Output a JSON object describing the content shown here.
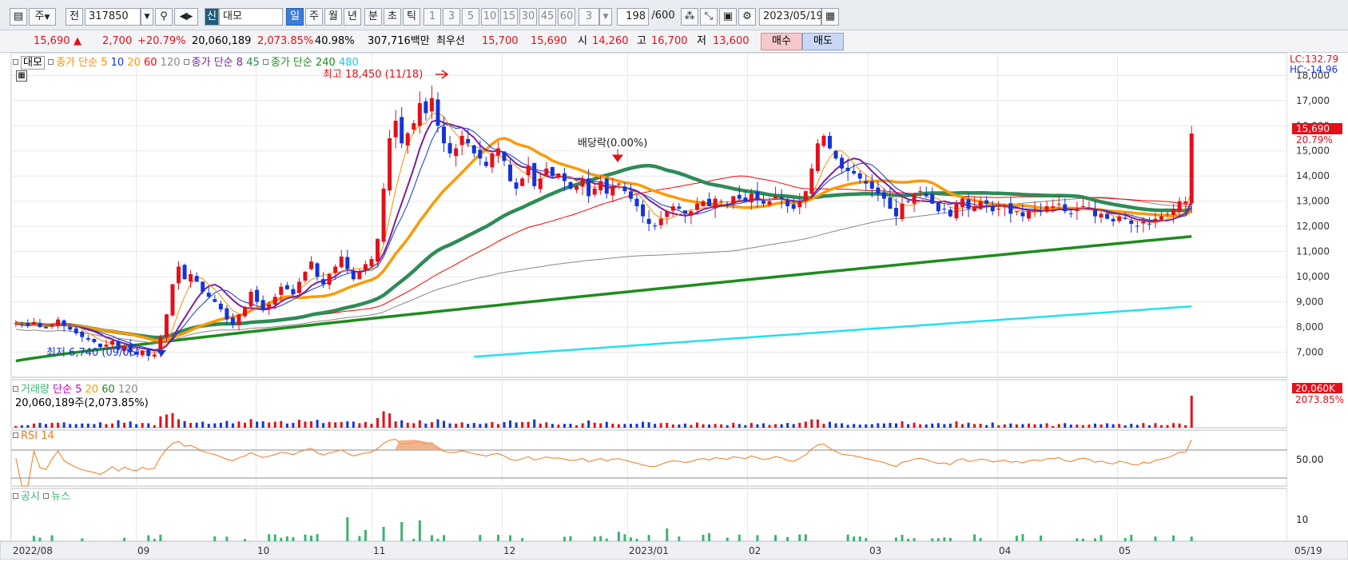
{
  "toolbar": {
    "period_select": "주",
    "prev_label": "전",
    "stock_code": "317850",
    "tag_new": "신",
    "stock_name": "대모",
    "periods": [
      "일",
      "주",
      "월",
      "년",
      "분",
      "초",
      "틱"
    ],
    "active_period": "일",
    "intervals": [
      "1",
      "3",
      "5",
      "10",
      "15",
      "30",
      "45",
      "60"
    ],
    "interval_value": "3",
    "count_value": "198",
    "count_total": "/600",
    "date": "2023/05/19"
  },
  "info": {
    "price": "15,690",
    "arrow": "▲",
    "change": "2,700",
    "change_pct": "+20.79%",
    "volume": "20,060,189",
    "volume_pct": "2,073.85%",
    "ratio": "40.98%",
    "amount": "307,716백만",
    "best_label": "최우선",
    "best_ask": "15,700",
    "best_bid": "15,690",
    "open_label": "시",
    "open": "14,260",
    "high_label": "고",
    "high": "16,700",
    "low_label": "저",
    "low": "13,600",
    "buy_label": "매수",
    "sell_label": "매도"
  },
  "legend": {
    "name": "대모",
    "ma_group1": "종가 단순",
    "ma1": [
      "5",
      "10",
      "20",
      "60",
      "120"
    ],
    "ma_group2": "종가 단순",
    "ma2": [
      "8",
      "45"
    ],
    "ma_group3": "종가 단순",
    "ma3": [
      "240",
      "480"
    ],
    "volume_label": "거래량",
    "volume_ma_label": "단순",
    "volume_ma": [
      "5",
      "20",
      "60",
      "120"
    ],
    "volume_value": "20,060,189주(2,073.85%)",
    "rsi_label": "RSI 14",
    "disclosure_label": "공시",
    "news_label": "뉴스"
  },
  "annotations": {
    "high_note": "최고 18,450 (11/18)",
    "low_note": "최저 6,740 (09/06)",
    "dividend_note": "배당락(0.00%)"
  },
  "right_axis": {
    "lc": "LC:132.79",
    "hc": "HC:-14.96",
    "current_price": "15,690",
    "current_pct": "20.79%",
    "vol_current": "20,060K",
    "vol_pct": "2073.85%",
    "rsi_level": "50.00",
    "news_level": "10"
  },
  "chart_data": {
    "type": "candlestick",
    "y_ticks": [
      "7,000",
      "8,000",
      "9,000",
      "10,000",
      "11,000",
      "12,000",
      "13,000",
      "14,000",
      "15,000",
      "16,000",
      "17,000",
      "18,000"
    ],
    "ylim": [
      6000,
      18900
    ],
    "x_ticks": [
      "2022/08",
      "09",
      "10",
      "11",
      "12",
      "2023/01",
      "02",
      "03",
      "04",
      "05",
      "05/19"
    ],
    "colors": {
      "up": "#e3101a",
      "down": "#1434d8",
      "ma5": "#ff8c00",
      "ma20_thick": "#ff9900",
      "ma60": "#ff0000",
      "ma120": "#888888",
      "ma8": "#7a1fa2",
      "ma45": "#2e8b57",
      "ma240": "#1e8c1e",
      "ma480": "#22e0f0",
      "rsi": "#f07820",
      "volume_up": "#e3101a",
      "volume_down": "#1434d8",
      "disclosure": "#3cb371"
    },
    "close": [
      8150,
      8100,
      8050,
      8200,
      8000,
      7950,
      8100,
      8300,
      8050,
      7900,
      7750,
      7600,
      7500,
      7400,
      7200,
      7300,
      7450,
      7100,
      7250,
      7000,
      6900,
      7050,
      6850,
      6900,
      7600,
      8500,
      9700,
      10400,
      9900,
      10100,
      9800,
      9400,
      9200,
      9000,
      8700,
      8300,
      8100,
      8500,
      8800,
      9400,
      9000,
      8700,
      8900,
      9200,
      9600,
      9500,
      9300,
      9800,
      10200,
      10600,
      10000,
      9700,
      10100,
      10400,
      10800,
      10300,
      9900,
      10200,
      10500,
      10700,
      11500,
      13500,
      15500,
      16200,
      15300,
      15700,
      16100,
      16900,
      16500,
      17100,
      16000,
      15300,
      14900,
      15100,
      15600,
      15300,
      14900,
      14700,
      14400,
      14900,
      15100,
      14600,
      13800,
      13500,
      13900,
      14400,
      13600,
      13900,
      14300,
      14000,
      14100,
      13800,
      13500,
      13600,
      13900,
      13200,
      13500,
      13800,
      13300,
      13600,
      13700,
      13400,
      13100,
      12800,
      12400,
      12100,
      12000,
      12300,
      12600,
      12800,
      12700,
      12500,
      12600,
      12900,
      13000,
      12800,
      13100,
      13000,
      12900,
      13200,
      13100,
      13000,
      13300,
      13100,
      12900,
      13000,
      13200,
      13100,
      12800,
      12700,
      13000,
      13400,
      14300,
      15300,
      15600,
      15100,
      14700,
      14300,
      14200,
      14100,
      13900,
      13700,
      13500,
      13300,
      13100,
      12700,
      12400,
      12900,
      13000,
      13300,
      13400,
      13200,
      12900,
      12600,
      12700,
      12400,
      12900,
      13100,
      12700,
      12800,
      13000,
      12900,
      12600,
      12700,
      12800,
      12500,
      12600,
      12400,
      12600,
      12700,
      12600,
      12800,
      12800,
      12900,
      12600,
      12500,
      12700,
      12800,
      12700,
      12400,
      12500,
      12300,
      12200,
      12400,
      12300,
      12100,
      12000,
      12200,
      12100,
      12300,
      12400,
      12500,
      12700,
      13000,
      12990,
      15690
    ]
  }
}
